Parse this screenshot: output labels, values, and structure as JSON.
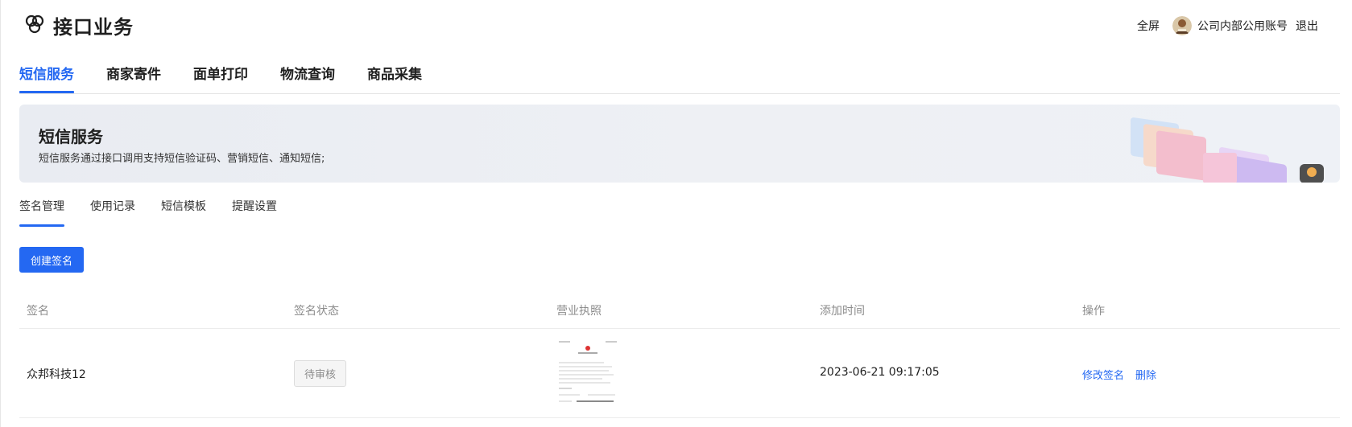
{
  "header": {
    "title": "接口业务",
    "fullscreen_label": "全屏",
    "account_name": "公司内部公用账号",
    "logout_label": "退出"
  },
  "main_tabs": [
    {
      "label": "短信服务",
      "active": true
    },
    {
      "label": "商家寄件",
      "active": false
    },
    {
      "label": "面单打印",
      "active": false
    },
    {
      "label": "物流查询",
      "active": false
    },
    {
      "label": "商品采集",
      "active": false
    }
  ],
  "banner": {
    "title": "短信服务",
    "description": "短信服务通过接口调用支持短信验证码、营销短信、通知短信;"
  },
  "sub_tabs": [
    {
      "label": "签名管理",
      "active": true
    },
    {
      "label": "使用记录",
      "active": false
    },
    {
      "label": "短信模板",
      "active": false
    },
    {
      "label": "提醒设置",
      "active": false
    }
  ],
  "create_button_label": "创建签名",
  "table": {
    "columns": [
      "签名",
      "签名状态",
      "营业执照",
      "添加时间",
      "操作"
    ],
    "rows": [
      {
        "signature": "众邦科技12",
        "status": "待审核",
        "added_time": "2023-06-21 09:17:05",
        "actions": [
          "修改签名",
          "删除"
        ]
      }
    ]
  },
  "colors": {
    "accent": "#2468f2",
    "text": "#1f1f1f",
    "muted": "#8c8c8c"
  },
  "icons": [
    "logo-icon",
    "avatar"
  ]
}
